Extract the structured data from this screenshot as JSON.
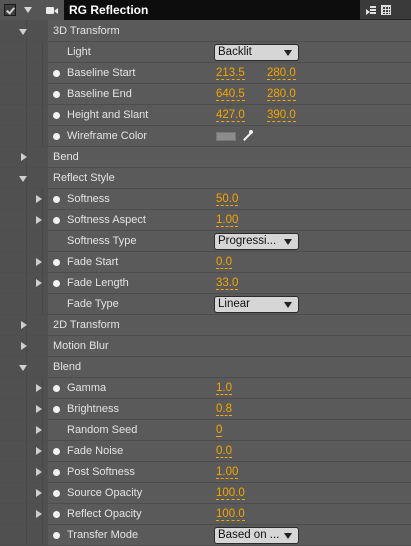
{
  "effect": {
    "title": "RG Reflection",
    "icons": [
      "fx-checkbox",
      "camera-icon",
      "panel-menu-icon",
      "grid-icon"
    ]
  },
  "colors": {
    "value_orange": "#f5a600",
    "title_bg": "#0d0d0d",
    "panel_bg": "#5a5a5a"
  },
  "groups": {
    "g3d": {
      "label": "3D Transform",
      "light": {
        "label": "Light",
        "value": "Backlit"
      },
      "baseline_start": {
        "label": "Baseline Start",
        "x": "213.5",
        "y": "280.0"
      },
      "baseline_end": {
        "label": "Baseline End",
        "x": "640.5",
        "y": "280.0"
      },
      "height_slant": {
        "label": "Height and Slant",
        "x": "427.0",
        "y": "390.0"
      },
      "wireframe": {
        "label": "Wireframe Color"
      }
    },
    "bend": {
      "label": "Bend"
    },
    "reflect": {
      "label": "Reflect Style",
      "softness": {
        "label": "Softness",
        "value": "50.0"
      },
      "softness_aspect": {
        "label": "Softness Aspect",
        "value": "1.00"
      },
      "softness_type": {
        "label": "Softness Type",
        "value": "Progressi..."
      },
      "fade_start": {
        "label": "Fade Start",
        "value": "0.0"
      },
      "fade_length": {
        "label": "Fade Length",
        "value": "33.0"
      },
      "fade_type": {
        "label": "Fade Type",
        "value": "Linear"
      }
    },
    "t2d": {
      "label": "2D Transform"
    },
    "motion": {
      "label": "Motion Blur"
    },
    "blend": {
      "label": "Blend",
      "gamma": {
        "label": "Gamma",
        "value": "1.0"
      },
      "brightness": {
        "label": "Brightness",
        "value": "0.8"
      },
      "seed": {
        "label": "Random Seed",
        "value": "0"
      },
      "fade_noise": {
        "label": "Fade Noise",
        "value": "0.0"
      },
      "post_softness": {
        "label": "Post Softness",
        "value": "1.00"
      },
      "source_opacity": {
        "label": "Source Opacity",
        "value": "100.0"
      },
      "reflect_opacity": {
        "label": "Reflect Opacity",
        "value": "100.0"
      },
      "transfer_mode": {
        "label": "Transfer Mode",
        "value": "Based on ..."
      }
    }
  }
}
